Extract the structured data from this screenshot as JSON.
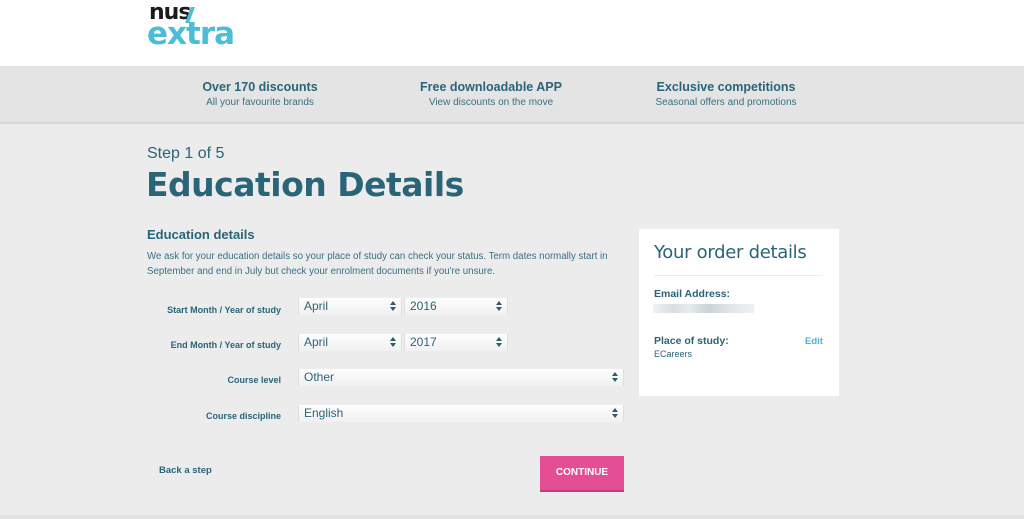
{
  "brand": {
    "logo_top": "nus",
    "logo_bottom": "extra"
  },
  "banner": {
    "features": [
      {
        "title": "Over 170 discounts",
        "subtitle": "All your favourite brands"
      },
      {
        "title": "Free downloadable APP",
        "subtitle": "View discounts on the move"
      },
      {
        "title": "Exclusive competitions",
        "subtitle": "Seasonal offers and promotions"
      }
    ]
  },
  "page": {
    "step": "Step 1 of 5",
    "title": "Education Details"
  },
  "form": {
    "section_title": "Education details",
    "description": "We ask for your education details so your place of study can check your status. Term dates normally start in September and end in July but check your enrolment documents if you're unsure.",
    "start_label": "Start Month / Year of study",
    "start_month": "April",
    "start_year": "2016",
    "end_label": "End Month / Year of study",
    "end_month": "April",
    "end_year": "2017",
    "course_level_label": "Course level",
    "course_level": "Other",
    "course_discipline_label": "Course discipline",
    "course_discipline": "English",
    "back_label": "Back a step",
    "continue_label": "CONTINUE"
  },
  "order": {
    "title": "Your order details",
    "email_label": "Email Address:",
    "place_label": "Place of study:",
    "place_value": "ECareers",
    "edit_label": "Edit"
  },
  "colors": {
    "primary": "#2a6478",
    "accent": "#4bbdd6",
    "cta": "#e44e95"
  }
}
